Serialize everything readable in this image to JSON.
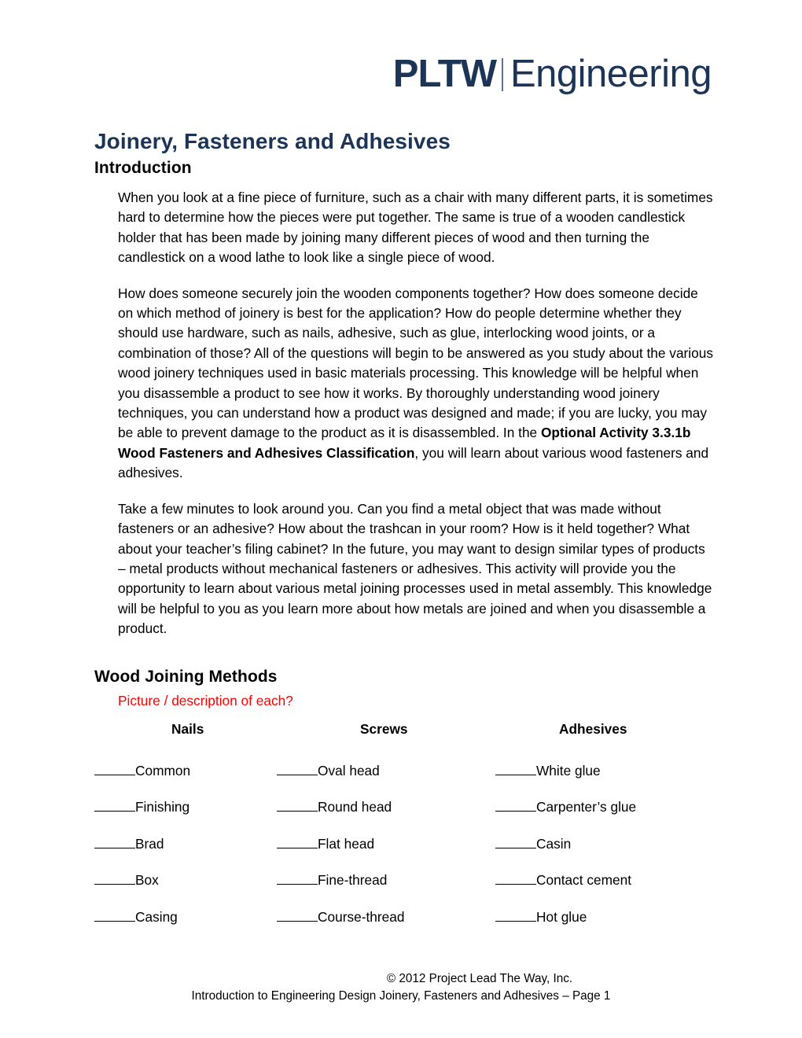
{
  "header": {
    "logo_primary": "PLTW",
    "logo_secondary": "Engineering",
    "logo_color": "#1c3557"
  },
  "document": {
    "title": "Joinery, Fasteners and Adhesives",
    "title_color": "#1c3557"
  },
  "introduction": {
    "heading": "Introduction",
    "paragraph_1": "When you look at a fine piece of furniture, such as a chair with many different parts, it is sometimes hard to determine how the pieces were put together. The same is true of a wooden candlestick holder that has been made by joining many different pieces of wood and then turning the candlestick on a wood lathe to look like a single piece of wood.",
    "paragraph_2_part_1": "How does someone securely join the wooden components together? How does someone decide on which method of joinery is best for the application? How do people determine whether they should use hardware, such as nails, adhesive, such as glue, interlocking wood joints, or a combination of those? All of the questions will begin to be answered as you study about the various wood joinery techniques used in basic materials processing. This knowledge will be helpful when you disassemble a product to see how it works. By thoroughly understanding wood joinery techniques, you can understand how a product was designed and made; if you are lucky, you may be able to prevent damage to the product as it is disassembled. In the ",
    "paragraph_2_bold": "Optional Activity 3.3.1b Wood Fasteners and Adhesives Classification",
    "paragraph_2_part_2": ", you will learn about various wood fasteners and adhesives.",
    "paragraph_3": "Take a few minutes to look around you. Can you find a metal object that was made without fasteners or an adhesive? How about the trashcan in your room? How is it held together? What about your teacher’s filing cabinet? In the future, you may want to design similar types of products – metal products without mechanical fasteners or adhesives. This activity will provide you the opportunity to learn about various metal joining processes used in metal assembly. This knowledge will be helpful to you as you learn more about how metals are joined and when you disassemble a product."
  },
  "wood_joining": {
    "heading": "Wood Joining Methods",
    "note": "Picture / description of each?",
    "note_color": "#ff0000",
    "column_headers": [
      "Nails",
      "Screws",
      "Adhesives"
    ],
    "rows": [
      [
        "Common",
        "Oval head",
        "White glue"
      ],
      [
        "Finishing",
        "Round head",
        "Carpenter’s glue"
      ],
      [
        "Brad",
        "Flat head",
        "Casin"
      ],
      [
        "Box",
        "Fine-thread",
        "Contact cement"
      ],
      [
        "Casing",
        "Course-thread",
        "Hot glue"
      ]
    ]
  },
  "footer": {
    "copyright": "© 2012 Project Lead The Way, Inc.",
    "page_line": "Introduction to Engineering Design Joinery, Fasteners and Adhesives – Page 1"
  }
}
